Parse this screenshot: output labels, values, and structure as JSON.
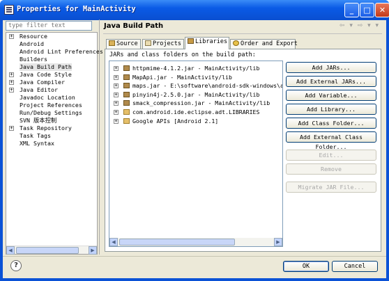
{
  "window": {
    "title": "Properties for MainActivity"
  },
  "filter": {
    "placeholder": "type filter text"
  },
  "sidebar": {
    "items": [
      {
        "label": "Resource",
        "expandable": true
      },
      {
        "label": "Android",
        "expandable": false
      },
      {
        "label": "Android Lint Preferences",
        "expandable": false
      },
      {
        "label": "Builders",
        "expandable": false
      },
      {
        "label": "Java Build Path",
        "expandable": false,
        "selected": true
      },
      {
        "label": "Java Code Style",
        "expandable": true
      },
      {
        "label": "Java Compiler",
        "expandable": true
      },
      {
        "label": "Java Editor",
        "expandable": true
      },
      {
        "label": "Javadoc Location",
        "expandable": false
      },
      {
        "label": "Project References",
        "expandable": false
      },
      {
        "label": "Run/Debug Settings",
        "expandable": false
      },
      {
        "label": "SVN 版本控制",
        "expandable": false
      },
      {
        "label": "Task Repository",
        "expandable": true
      },
      {
        "label": "Task Tags",
        "expandable": false
      },
      {
        "label": "XML Syntax",
        "expandable": false
      }
    ]
  },
  "header": {
    "title": "Java Build Path",
    "nav": "⇦ ▾ ⇨ ▾ ▾"
  },
  "tabs": [
    {
      "label": "Source"
    },
    {
      "label": "Projects"
    },
    {
      "label": "Libraries",
      "active": true
    },
    {
      "label": "Order and Export"
    }
  ],
  "libraries": {
    "label": "JARs and class folders on the build path:",
    "items": [
      {
        "label": "httpmime-4.1.2.jar - MainActivity/lib",
        "icon": "jar-icon"
      },
      {
        "label": "MapApi.jar - MainActivity/lib",
        "icon": "jar-icon"
      },
      {
        "label": "maps.jar - E:\\software\\android-sdk-windows\\add-on",
        "icon": "jar-icon"
      },
      {
        "label": "pinyin4j-2.5.0.jar - MainActivity/lib",
        "icon": "jar-icon"
      },
      {
        "label": "smack_compression.jar - MainActivity/lib",
        "icon": "jar-icon"
      },
      {
        "label": "com.android.ide.eclipse.adt.LIBRARIES",
        "icon": "library-icon"
      },
      {
        "label": "Google APIs [Android 2.1]",
        "icon": "library-icon"
      }
    ]
  },
  "buttons": [
    {
      "label": "Add JARs...",
      "enabled": true
    },
    {
      "label": "Add External JARs...",
      "enabled": true
    },
    {
      "label": "Add Variable...",
      "enabled": true
    },
    {
      "label": "Add Library...",
      "enabled": true
    },
    {
      "label": "Add Class Folder...",
      "enabled": true
    },
    {
      "label": "Add External Class Folder...",
      "enabled": true
    },
    {
      "label": "Edit...",
      "enabled": false
    },
    {
      "label": "Remove",
      "enabled": false
    },
    {
      "label": "Migrate JAR File...",
      "enabled": false
    }
  ],
  "footer": {
    "ok_label": "OK",
    "cancel_label": "Cancel",
    "help": "?"
  },
  "colors": {
    "titlebar": "#0a5ae6",
    "dialog_bg": "#ece9d8"
  }
}
